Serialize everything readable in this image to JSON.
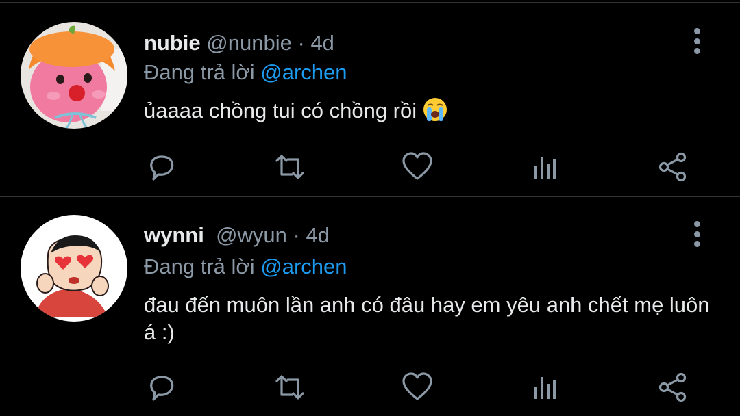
{
  "colors": {
    "background": "#000000",
    "primary_text": "#e7e9ea",
    "secondary_text": "#8b98a5",
    "link": "#1d9bf0",
    "divider": "#2f3336"
  },
  "tweets": [
    {
      "display_name": "nubie",
      "handle": "@nunbie",
      "separator": "·",
      "time": "4d",
      "replying_prefix": "Đang trả lời",
      "replying_to": "@archen",
      "text": "ủaaaa chồng tui có chồng rồi",
      "emoji": "loudly-crying-face",
      "avatar": "pink-plush-with-orange-hat"
    },
    {
      "display_name": "wynni",
      "handle": "@wyun",
      "separator": "·",
      "time": "4d",
      "replying_prefix": "Đang trả lời",
      "replying_to": "@archen",
      "text": "đau đến muôn lần anh có đâu hay em yêu anh chết mẹ luôn á :)",
      "avatar": "cartoon-boy-heart-eyes"
    }
  ],
  "action_icons": [
    "reply-icon",
    "retweet-icon",
    "like-icon",
    "analytics-icon",
    "share-icon"
  ]
}
